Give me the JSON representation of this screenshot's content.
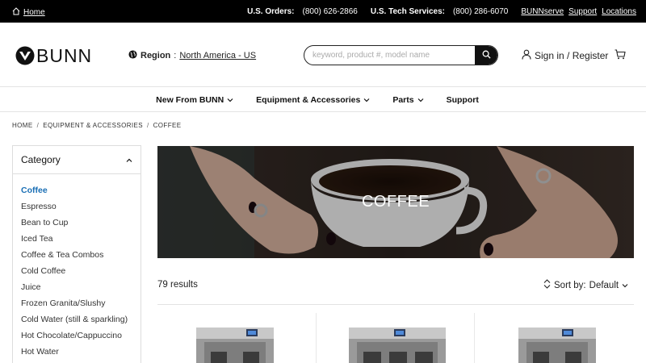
{
  "topbar": {
    "home_label": "Home",
    "orders_label": "U.S. Orders:",
    "orders_phone": "(800) 626-2866",
    "tech_label": "U.S. Tech Services:",
    "tech_phone": "(800) 286-6070",
    "links": [
      "BUNNserve",
      "Support",
      "Locations"
    ]
  },
  "header": {
    "logo_text": "BUNN",
    "region_label": "Region",
    "region_value": "North America - US",
    "search_placeholder": "keyword, product #, model name",
    "signin_label": "Sign in / Register"
  },
  "nav": {
    "items": [
      {
        "label": "New From BUNN",
        "dropdown": true
      },
      {
        "label": "Equipment & Accessories",
        "dropdown": true
      },
      {
        "label": "Parts",
        "dropdown": true
      },
      {
        "label": "Support",
        "dropdown": false
      }
    ]
  },
  "breadcrumb": [
    "HOME",
    "EQUIPMENT & ACCESSORIES",
    "COFFEE"
  ],
  "sidebar": {
    "title": "Category",
    "items": [
      {
        "label": "Coffee",
        "active": true
      },
      {
        "label": "Espresso",
        "active": false
      },
      {
        "label": "Bean to Cup",
        "active": false
      },
      {
        "label": "Iced Tea",
        "active": false
      },
      {
        "label": "Coffee & Tea Combos",
        "active": false
      },
      {
        "label": "Cold Coffee",
        "active": false
      },
      {
        "label": "Juice",
        "active": false
      },
      {
        "label": "Frozen Granita/Slushy",
        "active": false
      },
      {
        "label": "Cold Water (still & sparkling)",
        "active": false
      },
      {
        "label": "Hot Chocolate/Cappuccino",
        "active": false
      },
      {
        "label": "Hot Water",
        "active": false
      }
    ]
  },
  "banner": {
    "title": "COFFEE"
  },
  "results": {
    "count_text": "79 results",
    "sort_label": "Sort by:",
    "sort_value": "Default"
  },
  "colors": {
    "accent": "#1a6fb5",
    "topbar": "#000000",
    "text": "#222222"
  },
  "products": [
    {
      "icon": "coffee-brewer-image"
    },
    {
      "icon": "coffee-brewer-image"
    },
    {
      "icon": "coffee-brewer-image"
    }
  ]
}
